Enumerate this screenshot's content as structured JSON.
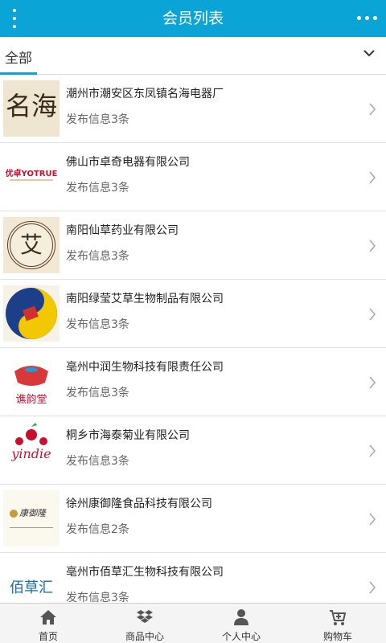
{
  "header": {
    "title": "会员列表",
    "menu_icon": "vertical-dots-icon",
    "more_icon": "horizontal-dots-icon"
  },
  "filter": {
    "label": "全部",
    "icon": "chevron-down-icon"
  },
  "members": [
    {
      "name": "潮州市潮安区东凤镇名海电器厂",
      "count": "发布信息3条",
      "logo_text": "名海"
    },
    {
      "name": "佛山市卓奇电器有限公司",
      "count": "发布信息3条",
      "logo_text": "优卓YOTRUE"
    },
    {
      "name": "南阳仙草药业有限公司",
      "count": "发布信息3条",
      "logo_text": "艾"
    },
    {
      "name": "南阳绿莹艾草生物制品有限公司",
      "count": "发布信息3条",
      "logo_text": ""
    },
    {
      "name": "亳州中润生物科技有限责任公司",
      "count": "发布信息3条",
      "logo_text": "谯韵堂"
    },
    {
      "name": "桐乡市海泰菊业有限公司",
      "count": "发布信息3条",
      "logo_text": "yindie"
    },
    {
      "name": "徐州康御隆食品科技有限公司",
      "count": "发布信息2条",
      "logo_text": "康御隆"
    },
    {
      "name": "亳州市佰草汇生物科技有限公司",
      "count": "发布信息3条",
      "logo_text": "佰草汇"
    }
  ],
  "tabbar": [
    {
      "label": "首页",
      "icon": "home-icon"
    },
    {
      "label": "商品中心",
      "icon": "dropbox-icon"
    },
    {
      "label": "个人中心",
      "icon": "user-icon"
    },
    {
      "label": "购物车",
      "icon": "cart-icon"
    }
  ],
  "colors": {
    "accent": "#0aa4d6"
  }
}
